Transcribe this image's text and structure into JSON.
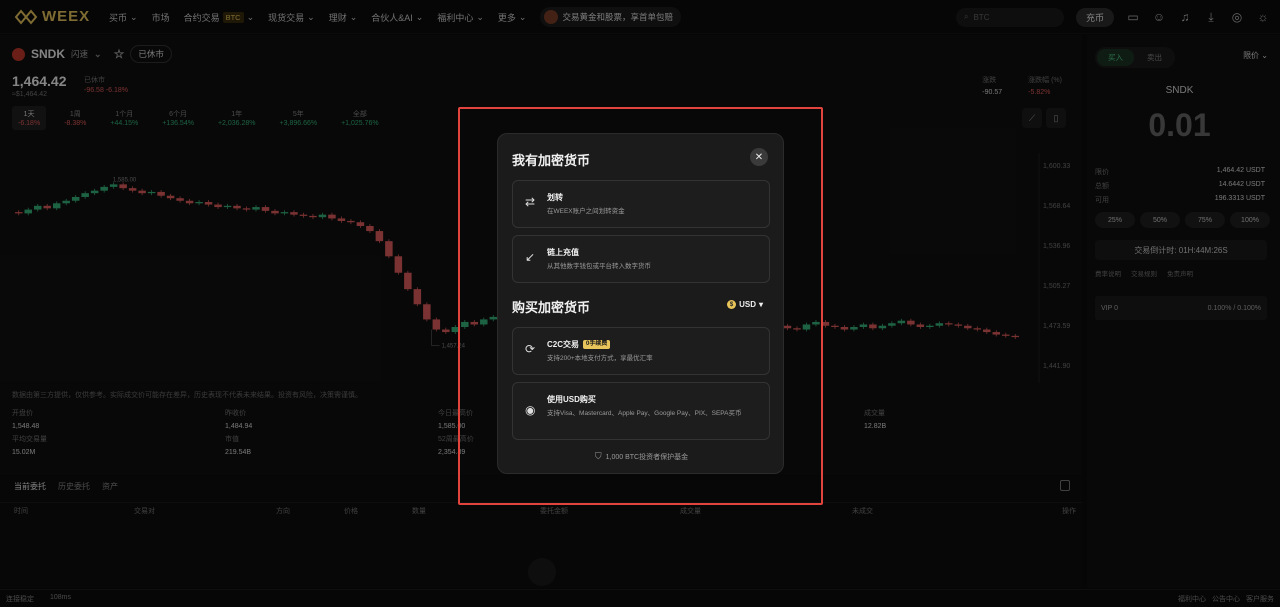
{
  "colors": {
    "accent": "#e8c55b",
    "up": "#35b27a",
    "down": "#e15b5b",
    "highlight": "#e0443d"
  },
  "nav": {
    "logo": "WEEX",
    "items": [
      {
        "label": "买币",
        "dropdown": true
      },
      {
        "label": "市场",
        "dropdown": false
      },
      {
        "label": "合约交易",
        "badge": "BTC",
        "dropdown": true
      },
      {
        "label": "现货交易",
        "dropdown": true
      },
      {
        "label": "理财",
        "dropdown": true
      },
      {
        "label": "合伙人&AI",
        "dropdown": true
      },
      {
        "label": "福利中心",
        "dropdown": true
      },
      {
        "label": "更多",
        "dropdown": true
      }
    ],
    "promo": "交易黄金和股票，享首单包赔",
    "search_placeholder": "BTC",
    "deposit_label": "充币",
    "icons": [
      "wallet-icon",
      "user-icon",
      "bell-icon",
      "download-icon",
      "globe-icon",
      "sun-icon"
    ]
  },
  "market": {
    "symbol": "SNDK",
    "flash": "闪速",
    "status": "已休市",
    "price": "1,464.42",
    "sub_price": "≈$1,464.42",
    "change_label": "已休市",
    "change_value": "-96.58 -6.18%",
    "stat_labels": [
      "涨跌",
      "涨跌幅 (%)"
    ],
    "stat_values": [
      "-90.57",
      "-5.82%"
    ],
    "ranges": [
      {
        "label": "1天",
        "pct": "-6.18%"
      },
      {
        "label": "1周",
        "pct": "-8.38%"
      },
      {
        "label": "1个月",
        "pct": "+44.15%"
      },
      {
        "label": "6个月",
        "pct": "+136.54%"
      },
      {
        "label": "1年",
        "pct": "+2,036.28%"
      },
      {
        "label": "5年",
        "pct": "+3,896.66%"
      },
      {
        "label": "全部",
        "pct": "+1,025.76%"
      }
    ]
  },
  "chart_data": {
    "type": "candlestick",
    "y_ticks": [
      "1,600.33",
      "1,568.64",
      "1,536.96",
      "1,505.27",
      "1,473.59",
      "1,441.90"
    ],
    "ylim": [
      1441.9,
      1600.33
    ],
    "annotations": [
      "1,585.00",
      "1,457.24"
    ],
    "last_price": 1464.42,
    "close_values": [
      1562,
      1565,
      1568,
      1566,
      1570,
      1572,
      1575,
      1578,
      1580,
      1583,
      1585,
      1582,
      1580,
      1578,
      1579,
      1576,
      1574,
      1572,
      1570,
      1571,
      1569,
      1567,
      1568,
      1566,
      1565,
      1567,
      1564,
      1562,
      1563,
      1561,
      1560,
      1559,
      1561,
      1558,
      1556,
      1555,
      1552,
      1548,
      1540,
      1528,
      1515,
      1502,
      1490,
      1478,
      1470,
      1468,
      1472,
      1476,
      1474,
      1478,
      1480,
      1477,
      1475,
      1479,
      1476,
      1474,
      1478,
      1480,
      1476,
      1473,
      1475,
      1477,
      1472,
      1470,
      1474,
      1476,
      1473,
      1471,
      1474,
      1477,
      1475,
      1473,
      1470,
      1472,
      1476,
      1474,
      1473,
      1471,
      1474,
      1476,
      1473,
      1471,
      1470,
      1474,
      1476,
      1473,
      1472,
      1470,
      1472,
      1474,
      1471,
      1473,
      1475,
      1477,
      1474,
      1472,
      1473,
      1475,
      1474,
      1473,
      1471,
      1470,
      1468,
      1466,
      1465,
      1464
    ]
  },
  "disclaimer": "数据由第三方提供，仅供参考。实际成交价可能存在差异，历史表现不代表未来结果。投资有风险，决策需谨慎。",
  "stats": [
    {
      "label": "开盘价",
      "value": "1,548.48"
    },
    {
      "label": "昨收价",
      "value": "1,484.94"
    },
    {
      "label": "今日最高价",
      "value": "1,585.00"
    },
    {
      "label": "成交量",
      "value": "12.82B"
    },
    {
      "label": "平均交易量",
      "value": "15.02M"
    },
    {
      "label": "市值",
      "value": "219.54B"
    },
    {
      "label": "52周最高价",
      "value": "2,354.89"
    }
  ],
  "orders": {
    "tabs": [
      "当前委托",
      "历史委托",
      "资产"
    ],
    "columns": [
      "时间",
      "交易对",
      "方向",
      "价格",
      "数量",
      "委托金额",
      "成交量",
      "未成交",
      "操作"
    ]
  },
  "right": {
    "buy": "买入",
    "sell": "卖出",
    "order_type": "限价",
    "symbol": "SNDK",
    "amount": "0.01",
    "rows": [
      {
        "label": "限价",
        "value": "1,464.42 USDT"
      },
      {
        "label": "总额",
        "value": "14.6442 USDT"
      },
      {
        "label": "可用",
        "value": "196.3313 USDT"
      }
    ],
    "pcts": [
      "25%",
      "50%",
      "75%",
      "100%"
    ],
    "countdown": "交易倒计时: 01H:44M:26S",
    "links": [
      "费率说明",
      "交易规则",
      "免责声明"
    ],
    "vip_label": "VIP 0",
    "vip_fee": "0.100% / 0.100%"
  },
  "status": {
    "left": "连接稳定",
    "latency": "108ms",
    "right_items": [
      "福利中心",
      "公告中心",
      "客户服务"
    ]
  },
  "modal": {
    "title": "我有加密货币",
    "options_have": [
      {
        "icon": "transfer-icon",
        "title": "划转",
        "desc": "在WEEX账户之间划转资金"
      },
      {
        "icon": "arrow-down-left-icon",
        "title": "链上充值",
        "desc": "从其他数字钱包或平台转入数字货币"
      }
    ],
    "buy_title": "购买加密货币",
    "currency": "USD",
    "options_buy": [
      {
        "icon": "c2c-icon",
        "title": "C2C交易",
        "badge": "0手续费",
        "desc": "支持200+本地支付方式，享最优汇率"
      },
      {
        "icon": "dollar-coin-icon",
        "title": "使用USD购买",
        "desc": "支持Visa、Mastercard、Apple Pay、Google Pay、PIX、SEPA买币"
      }
    ],
    "fund": "1,000 BTC投资者保护基金"
  }
}
